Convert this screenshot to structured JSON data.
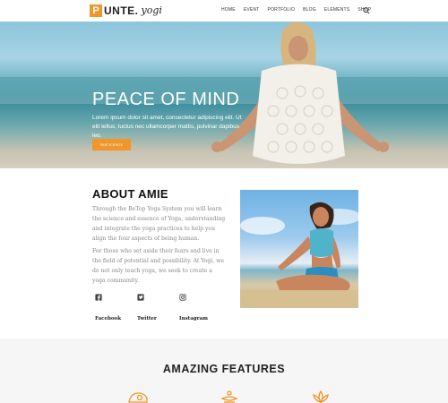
{
  "header": {
    "logo_letter": "P",
    "logo_text": "UNTE.",
    "logo_script": "yogi",
    "nav": [
      "HOME",
      "EVENT",
      "PORTFOLIO",
      "BLOG",
      "ELEMENTS",
      "SHOP"
    ],
    "search_icon": "search-icon"
  },
  "hero": {
    "title": "PEACE OF MIND",
    "text": "Lorem ipsum dolor sit amet, consectetur adipiscing elit. Ut elit tellus, luctus nec ullamcorper mattis, pulvinar dapibus leo.",
    "button_label": "PARTICIPATE"
  },
  "about": {
    "title": "ABOUT AMIE",
    "paragraph1": "Through the BeTop Yoga System you will learn the science and essence of Yoga, understanding and integrate the yoga practices to help you align the four aspects of being human.",
    "paragraph2": "For those who set aside their fears and live in the field of potential and possibility. At Yogi, we do not only teach yoga, we seek to create a yoga community.",
    "social": [
      {
        "label": "Facebook",
        "icon": "facebook-icon"
      },
      {
        "label": "Twitter",
        "icon": "twitter-icon"
      },
      {
        "label": "Instagram",
        "icon": "instagram-icon"
      }
    ]
  },
  "features": {
    "title": "AMAZING FEATURES",
    "icons": [
      "yoga-mat-icon",
      "meditation-bowl-icon",
      "lotus-icon"
    ]
  },
  "colors": {
    "accent": "#f0962a",
    "text_dark": "#222222",
    "text_muted": "#888888",
    "features_bg": "#f6f6f6"
  }
}
